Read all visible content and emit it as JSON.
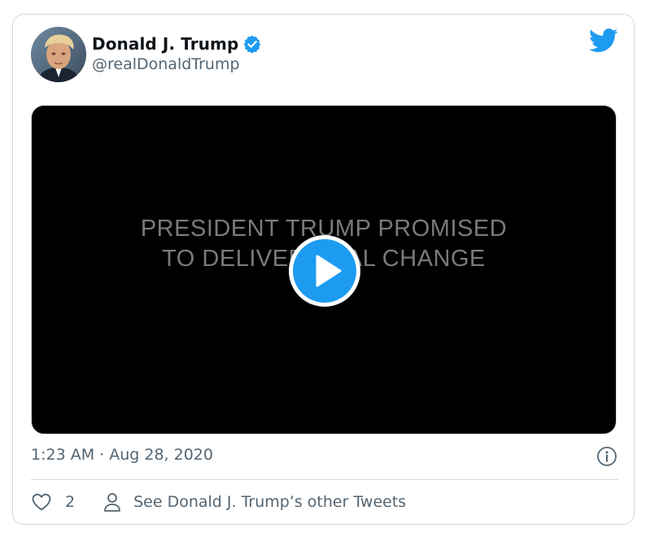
{
  "tweet": {
    "author": {
      "display_name": "Donald J. Trump",
      "handle": "@realDonaldTrump",
      "verified": true
    },
    "media": {
      "text_line1": "PRESIDENT TRUMP PROMISED",
      "text_line2": "TO DELIVER REAL CHANGE",
      "play_icon": "play-icon"
    },
    "timestamp": "1:23 AM · Aug 28, 2020",
    "actions": {
      "like_count": "2",
      "profile_link": "See Donald J. Trump’s other Tweets"
    }
  },
  "icons": {
    "brand": "twitter-bird-icon",
    "verified": "verified-badge-icon",
    "info": "info-icon",
    "like": "heart-icon",
    "profile": "person-icon"
  },
  "colors": {
    "brand": "#1d9bf0",
    "text_primary": "#0f1419",
    "text_secondary": "#536471",
    "border": "#cfd9de",
    "media_background": "#000000"
  }
}
